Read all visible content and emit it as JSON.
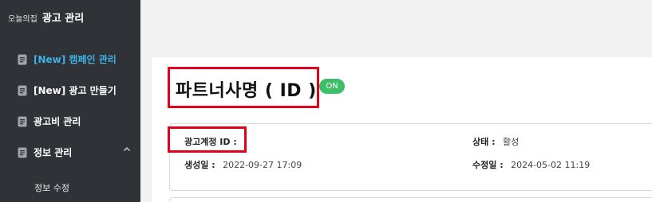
{
  "brand": {
    "small": "오늘의집",
    "big": "광고 관리"
  },
  "sidebar": {
    "items": [
      {
        "label": "[New] 캠페인 관리",
        "active": true
      },
      {
        "label": "[New] 광고 만들기",
        "active": false
      },
      {
        "label": "광고비 관리",
        "active": false
      },
      {
        "label": "정보 관리",
        "active": false,
        "expanded": true
      }
    ],
    "subitems": [
      {
        "label": "정보 수정"
      }
    ]
  },
  "header": {
    "title": "파트너사명 (  ID  )",
    "status_badge": "ON"
  },
  "account": {
    "id_label": "광고계정 ID :",
    "id_value": "",
    "status_label": "상태 :",
    "status_value": "활성",
    "created_label": "생성일 :",
    "created_value": "2022-09-27 17:09",
    "modified_label": "수정일 :",
    "modified_value": "2024-05-02 11:19"
  },
  "colors": {
    "sidebar_bg": "#2f3337",
    "active": "#3fb2e8",
    "on_badge": "#3fbf68",
    "highlight": "#e3001b"
  },
  "icons": {
    "nav": "document-icon",
    "expand": "chevron-up-icon"
  }
}
